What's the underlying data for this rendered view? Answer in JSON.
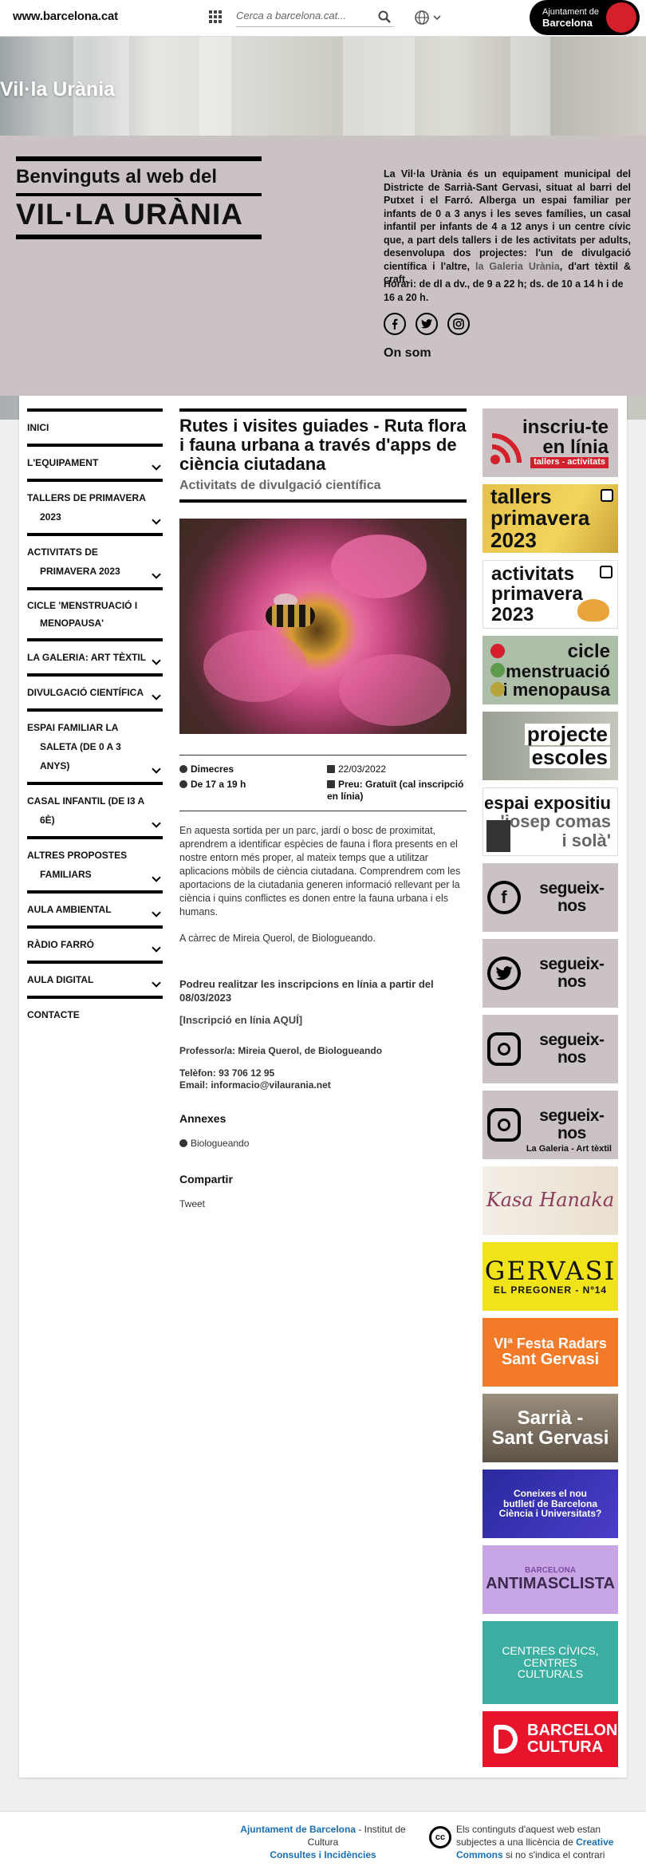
{
  "topbar": {
    "domain": "www.barcelona.cat",
    "search_placeholder": "Cerca a barcelona.cat...",
    "logo_line1": "Ajuntament de",
    "logo_line2": "Barcelona"
  },
  "hero": {
    "title": "Vil·la Urània"
  },
  "welcome": {
    "line1": "Benvinguts al web del",
    "line2": "VIL·LA URÀNIA",
    "description": "La Vil·la Urània és un equipament municipal del Districte de Sarrià-Sant Gervasi, situat al barri del Putxet i el Farró. Alberga un espai familiar per infants de 0 a 3 anys i les seves famílies, un casal infantil per infants de 4 a 12 anys i un centre cívic que, a part dels tallers i de les activitats per adults, desenvolupa dos projectes: l'un de divulgació científica i l'altre,",
    "description_link": "la Galeria Urània",
    "description_end": ", d'art tèxtil & craft.",
    "hours": "Horari: de dl a dv., de 9 a 22 h; ds. de 10 a 14 h i de 16 a 20 h.",
    "where": "On som"
  },
  "nav": {
    "items": [
      {
        "label": "INICI",
        "sub": ""
      },
      {
        "label": "L'EQUIPAMENT",
        "sub": ""
      },
      {
        "label": "TALLERS DE PRIMAVERA",
        "sub": "2023"
      },
      {
        "label": "ACTIVITATS DE",
        "sub": "PRIMAVERA 2023"
      },
      {
        "label": "CICLE 'MENSTRUACIÓ I",
        "sub": "MENOPAUSA'"
      },
      {
        "label": "LA GALERIA: ART TÈXTIL",
        "sub": ""
      },
      {
        "label": "DIVULGACIÓ CIENTÍFICA",
        "sub": ""
      },
      {
        "label": "ESPAI FAMILIAR LA",
        "sub": "SALETA (DE 0 A 3",
        "sub2": "ANYS)"
      },
      {
        "label": "CASAL INFANTIL (DE I3 A",
        "sub": "6È)"
      },
      {
        "label": "ALTRES PROPOSTES",
        "sub": "FAMILIARS"
      },
      {
        "label": "AULA AMBIENTAL",
        "sub": ""
      },
      {
        "label": "RÀDIO FARRÓ",
        "sub": ""
      },
      {
        "label": "AULA DIGITAL",
        "sub": ""
      },
      {
        "label": "CONTACTE",
        "sub": ""
      }
    ]
  },
  "article": {
    "title": "Rutes i visites guiades - Ruta flora i fauna urbana a través d'apps de ciència ciutadana",
    "subtitle": "Activitats de divulgació científica",
    "day": "Dimecres",
    "time": "De 17 a 19 h",
    "date": "22/03/2022",
    "price": "Preu: Gratuït (cal inscripció en línia)",
    "p1": "En aquesta sortida per un parc, jardí o bosc de proximitat, aprendrem a identificar espècies de fauna i flora presents en el nostre entorn més proper, al mateix temps que a utilitzar aplicacions mòbils de ciència ciutadana. Comprendrem com les aportacions de la ciutadania generen informació rellevant per la ciència i quins conflictes es donen entre la fauna urbana i els humans.",
    "p2": "A càrrec de Mireia Querol, de Biologueando.",
    "inscription": "Podreu realitzar les inscripcions en línia a partir del 08/03/2023",
    "inscription_link": "[Inscripció en línia AQUÍ]",
    "teacher": "Professor/a: Mireia Querol, de Biologueando",
    "phone": "Telèfon: 93 706 12 95",
    "email": "Email: informacio@vilaurania.net",
    "annex_title": "Annexes",
    "annex_item": "Biologueando",
    "share_title": "Compartir",
    "tweet": "Tweet"
  },
  "side": {
    "b1a": "inscriu-te",
    "b1b": "en línia",
    "b1c": "tallers - activitats",
    "b2a": "tallers",
    "b2b": "primavera",
    "b2c": "2023",
    "b3a": "activitats",
    "b3b": "primavera",
    "b3c": "2023",
    "b4a": "cicle",
    "b4b": "menstruació",
    "b4c": "i menopausa",
    "b5a": "projecte",
    "b5b": "escoles",
    "b6a": "espai expositiu",
    "b6b": "'josep comas",
    "b6c": "i solà'",
    "follow": "segueix-nos",
    "galeria": "La Galeria - Art tèxtil",
    "kasa": "Kasa Hanaka",
    "gervasi1": "GERVASI",
    "gervasi2": "EL PREGONER - Nº14",
    "festa1": "VIª Festa Radars",
    "festa2": "Sant Gervasi",
    "sarria1": "Sarrià -",
    "sarria2": "Sant Gervasi",
    "ciencia": "Coneixes el nou butlletí de Barcelona Ciència i Universitats?",
    "anti1": "BARCELONA",
    "anti2": "ANTIMASCLISTA",
    "centres": "CENTRES CÍVICS, CENTRES CULTURALS",
    "bcn1": "BARCELONA",
    "bcn2": "CULTURA"
  },
  "colors": {
    "accent_red": "#d3202b",
    "panel": "#cbc3c3",
    "link_blue": "#1a6fb3"
  },
  "footer": {
    "ajuntament": "Ajuntament de Barcelona",
    "institut": " - Institut de Cultura",
    "consultes": "Consultes i Incidències",
    "cc": "cc",
    "license_start": "Els continguts d'aquest web estan subjectes a una llicència de ",
    "license_link": "Creative Commons",
    "license_end": " si no s'indica el contrari"
  }
}
